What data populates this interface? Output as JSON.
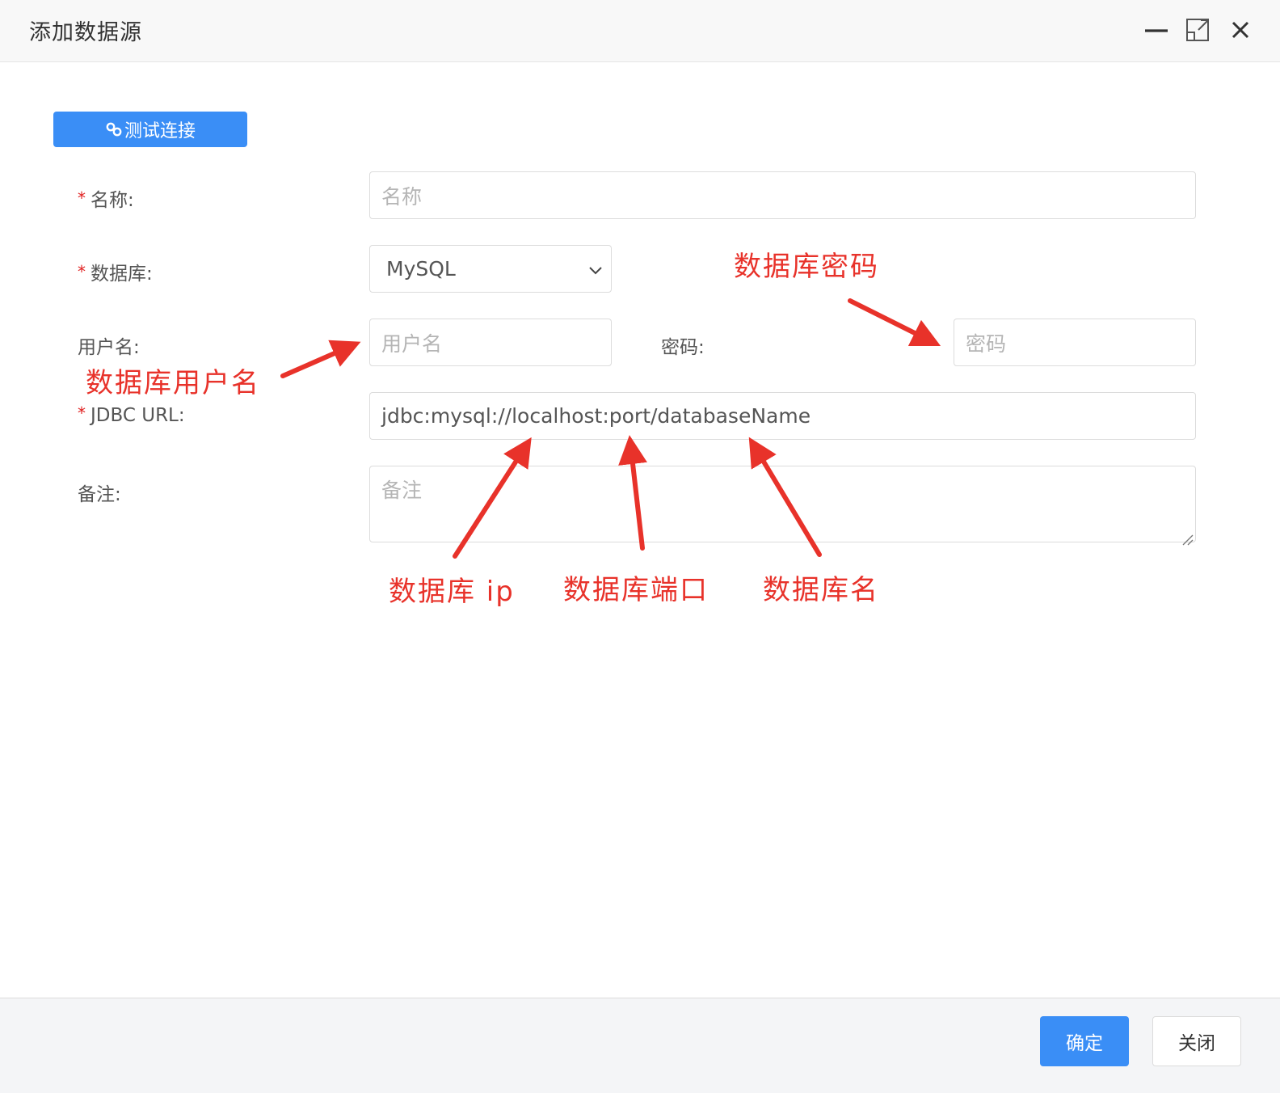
{
  "window": {
    "title": "添加数据源",
    "controls": [
      "minimize-icon",
      "maximize-icon",
      "close-icon"
    ]
  },
  "toolbar": {
    "test_connection_label": "测试连接",
    "test_connection_icon": "link-icon"
  },
  "form": {
    "name": {
      "label": "名称:",
      "required": true,
      "value": "",
      "placeholder": "名称"
    },
    "database": {
      "label": "数据库:",
      "required": true,
      "value": "MySQL"
    },
    "username": {
      "label": "用户名:",
      "required": false,
      "value": "",
      "placeholder": "用户名"
    },
    "password": {
      "label": "密码:",
      "required": false,
      "value": "",
      "placeholder": "密码"
    },
    "jdbc_url": {
      "label": "JDBC URL:",
      "required": true,
      "value": "jdbc:mysql://localhost:port/databaseName"
    },
    "remark": {
      "label": "备注:",
      "required": false,
      "value": "",
      "placeholder": "备注"
    }
  },
  "annotations": {
    "db_password": "数据库密码",
    "db_username": "数据库用户名",
    "db_ip": "数据库 ip",
    "db_port": "数据库端口",
    "db_name": "数据库名"
  },
  "footer": {
    "ok_label": "确定",
    "close_label": "关闭"
  },
  "colors": {
    "primary": "#3a8ef6",
    "annotation": "#e8322a",
    "required_mark": "#e02020"
  }
}
